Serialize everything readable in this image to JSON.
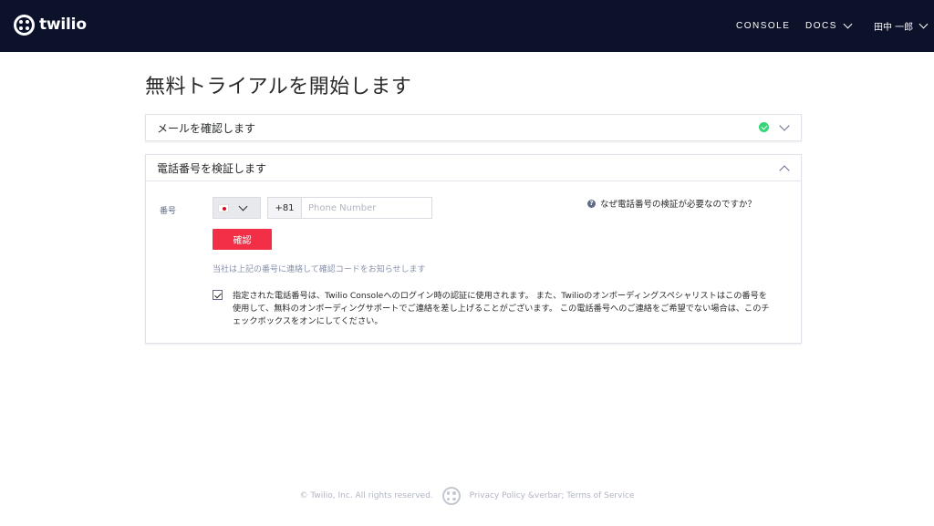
{
  "header": {
    "logo_text": "twilio",
    "nav": {
      "console": "CONSOLE",
      "docs": "DOCS",
      "user": "田中 一郎"
    }
  },
  "page_title": "無料トライアルを開始します",
  "email_section": {
    "title": "メールを確認します",
    "status": "verified"
  },
  "phone_section": {
    "title": "電話番号を検証します",
    "number_label": "番号",
    "country_flag": "JP",
    "prefix": "+81",
    "phone_placeholder": "Phone Number",
    "phone_value": "",
    "confirm_button": "確認",
    "help_note": "当社は上記の番号に連絡して確認コードをお知らせします",
    "why_link": "なぜ電話番号の検証が必要なのですか？",
    "consent_checked": true,
    "consent_text": "指定された電話番号は、Twilio Consoleへのログイン時の認証に使用されます。 また、Twilioのオンボーディングスペシャリストはこの番号を使用して、無料のオンボーディングサポートでご連絡を差し上げることがございます。 この電話番号へのご連絡をご希望でない場合は、このチェックボックスをオンにしてください。"
  },
  "footer": {
    "copyright": "© Twilio, Inc. All rights reserved.",
    "links": "Privacy Policy &verbar; Terms of Service"
  },
  "colors": {
    "header_bg": "#0d122b",
    "brand_red": "#f22f46",
    "success_green": "#36d576"
  }
}
